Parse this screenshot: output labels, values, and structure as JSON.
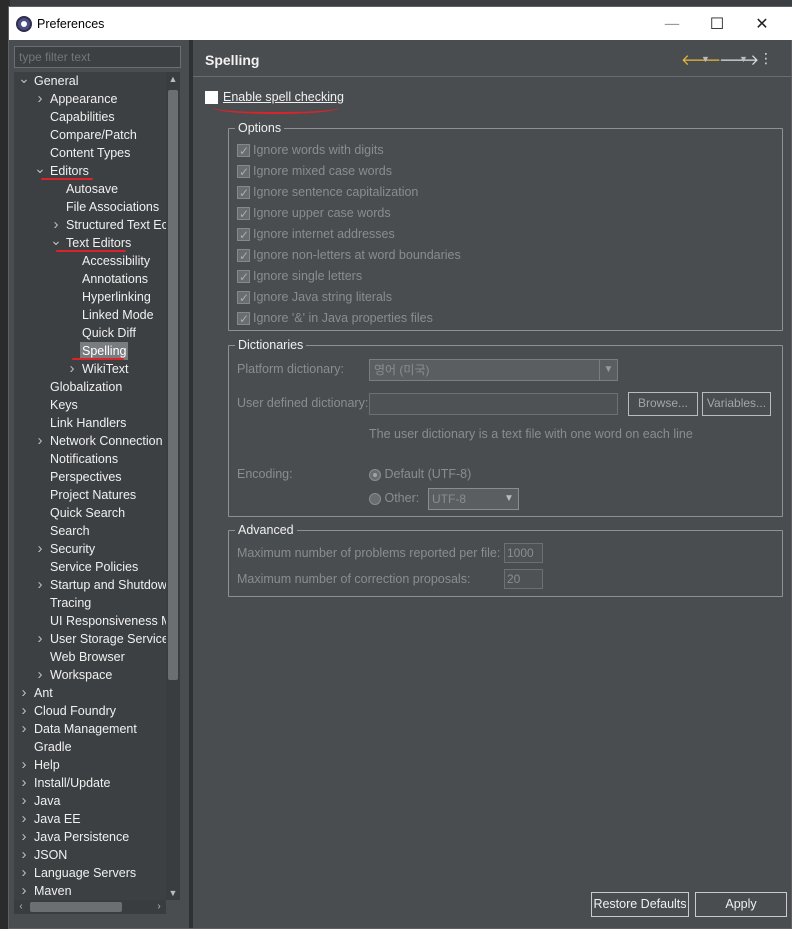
{
  "window": {
    "title": "Preferences",
    "minimize": "—",
    "maximize": "☐",
    "close": "✕"
  },
  "filter": {
    "placeholder": "type filter text"
  },
  "tree": [
    {
      "label": "General",
      "level": 0,
      "twisty": "v"
    },
    {
      "label": "Appearance",
      "level": 1,
      "twisty": ">"
    },
    {
      "label": "Capabilities",
      "level": 1,
      "twisty": ""
    },
    {
      "label": "Compare/Patch",
      "level": 1,
      "twisty": ""
    },
    {
      "label": "Content Types",
      "level": 1,
      "twisty": ""
    },
    {
      "label": "Editors",
      "level": 1,
      "twisty": "v"
    },
    {
      "label": "Autosave",
      "level": 2,
      "twisty": ""
    },
    {
      "label": "File Associations",
      "level": 2,
      "twisty": ""
    },
    {
      "label": "Structured Text Ec",
      "level": 2,
      "twisty": ">"
    },
    {
      "label": "Text Editors",
      "level": 2,
      "twisty": "v"
    },
    {
      "label": "Accessibility",
      "level": 3,
      "twisty": ""
    },
    {
      "label": "Annotations",
      "level": 3,
      "twisty": ""
    },
    {
      "label": "Hyperlinking",
      "level": 3,
      "twisty": ""
    },
    {
      "label": "Linked Mode",
      "level": 3,
      "twisty": ""
    },
    {
      "label": "Quick Diff",
      "level": 3,
      "twisty": ""
    },
    {
      "label": "Spelling",
      "level": 3,
      "twisty": "",
      "selected": true
    },
    {
      "label": "WikiText",
      "level": 3,
      "twisty": ">"
    },
    {
      "label": "Globalization",
      "level": 1,
      "twisty": ""
    },
    {
      "label": "Keys",
      "level": 1,
      "twisty": ""
    },
    {
      "label": "Link Handlers",
      "level": 1,
      "twisty": ""
    },
    {
      "label": "Network Connection",
      "level": 1,
      "twisty": ">"
    },
    {
      "label": "Notifications",
      "level": 1,
      "twisty": ""
    },
    {
      "label": "Perspectives",
      "level": 1,
      "twisty": ""
    },
    {
      "label": "Project Natures",
      "level": 1,
      "twisty": ""
    },
    {
      "label": "Quick Search",
      "level": 1,
      "twisty": ""
    },
    {
      "label": "Search",
      "level": 1,
      "twisty": ""
    },
    {
      "label": "Security",
      "level": 1,
      "twisty": ">"
    },
    {
      "label": "Service Policies",
      "level": 1,
      "twisty": ""
    },
    {
      "label": "Startup and Shutdow",
      "level": 1,
      "twisty": ">"
    },
    {
      "label": "Tracing",
      "level": 1,
      "twisty": ""
    },
    {
      "label": "UI Responsiveness M",
      "level": 1,
      "twisty": ""
    },
    {
      "label": "User Storage Service",
      "level": 1,
      "twisty": ">"
    },
    {
      "label": "Web Browser",
      "level": 1,
      "twisty": ""
    },
    {
      "label": "Workspace",
      "level": 1,
      "twisty": ">"
    },
    {
      "label": "Ant",
      "level": 0,
      "twisty": ">"
    },
    {
      "label": "Cloud Foundry",
      "level": 0,
      "twisty": ">"
    },
    {
      "label": "Data Management",
      "level": 0,
      "twisty": ">"
    },
    {
      "label": "Gradle",
      "level": 0,
      "twisty": ""
    },
    {
      "label": "Help",
      "level": 0,
      "twisty": ">"
    },
    {
      "label": "Install/Update",
      "level": 0,
      "twisty": ">"
    },
    {
      "label": "Java",
      "level": 0,
      "twisty": ">"
    },
    {
      "label": "Java EE",
      "level": 0,
      "twisty": ">"
    },
    {
      "label": "Java Persistence",
      "level": 0,
      "twisty": ">"
    },
    {
      "label": "JSON",
      "level": 0,
      "twisty": ">"
    },
    {
      "label": "Language Servers",
      "level": 0,
      "twisty": ">"
    },
    {
      "label": "Maven",
      "level": 0,
      "twisty": ">"
    }
  ],
  "page": {
    "title": "Spelling",
    "enable_spell_checking": {
      "label": "Enable spell checking",
      "checked": false
    },
    "options": {
      "legend": "Options",
      "items": [
        "Ignore words with digits",
        "Ignore mixed case words",
        "Ignore sentence capitalization",
        "Ignore upper case words",
        "Ignore internet addresses",
        "Ignore non-letters at word boundaries",
        "Ignore single letters",
        "Ignore Java string literals",
        "Ignore '&' in Java properties files"
      ]
    },
    "dictionaries": {
      "legend": "Dictionaries",
      "platform_label": "Platform dictionary:",
      "platform_value": "영어 (미국)",
      "user_label": "User defined dictionary:",
      "user_value": "",
      "browse": "Browse...",
      "variables": "Variables...",
      "hint": "The user dictionary is a text file with one word on each line",
      "encoding_label": "Encoding:",
      "encoding_default": "Default (UTF-8)",
      "encoding_other": "Other:",
      "encoding_other_value": "UTF-8"
    },
    "advanced": {
      "legend": "Advanced",
      "max_problems_label": "Maximum number of problems reported per file:",
      "max_problems_value": "1000",
      "max_proposals_label": "Maximum number of correction proposals:",
      "max_proposals_value": "20"
    },
    "restore_defaults": "Restore Defaults",
    "apply": "Apply"
  },
  "colors": {
    "annotation_red": "#d9242b",
    "panel_bg": "#4a4d50",
    "tree_bg": "#3d4043"
  }
}
